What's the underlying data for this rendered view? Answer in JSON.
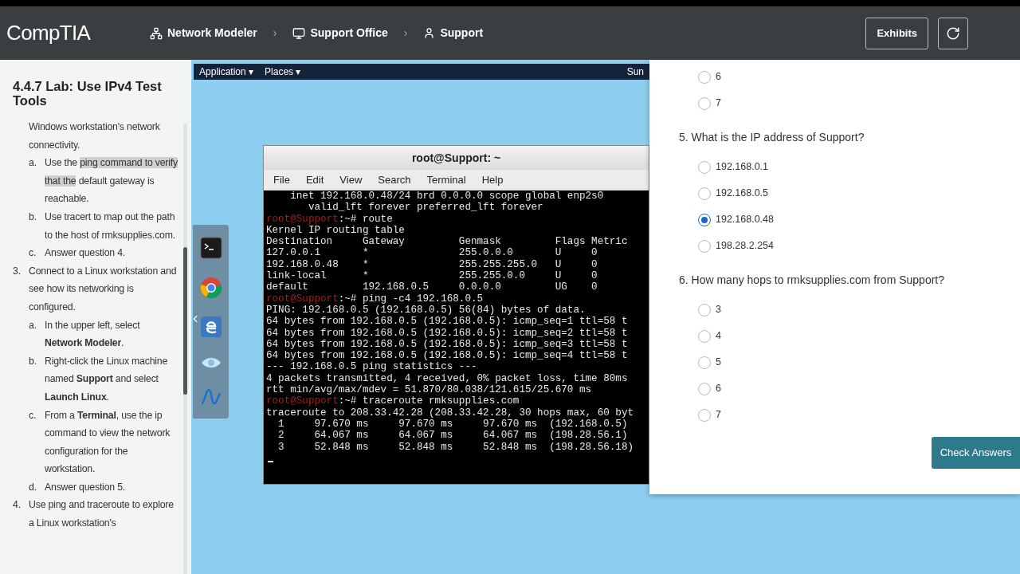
{
  "header": {
    "logo": "CompTIA",
    "breadcrumbs": [
      {
        "label": "Network Modeler"
      },
      {
        "label": "Support Office"
      },
      {
        "label": "Support"
      }
    ],
    "separator": "›",
    "exhibits": "Exhibits"
  },
  "instructions": {
    "title": "4.4.7 Lab: Use IPv4 Test Tools",
    "items": [
      {
        "segments": [
          {
            "text": "Windows workstation's network connectivity.",
            "highlighted": false
          }
        ],
        "children": [
          {
            "marker": "a.",
            "segments": [
              {
                "text": "Use the ",
                "highlighted": false
              },
              {
                "text": "ping command to verify that the",
                "highlighted": true
              },
              {
                "text": " default gateway is reachable.",
                "highlighted": false
              }
            ]
          },
          {
            "marker": "b.",
            "segments": [
              {
                "text": "Use tracert to map out the path to the host of rmksupplies.com.",
                "highlighted": false
              }
            ]
          },
          {
            "marker": "c.",
            "segments": [
              {
                "text": "Answer question 4.",
                "highlighted": false
              }
            ]
          }
        ]
      },
      {
        "marker": "3.",
        "segments": [
          {
            "text": "Connect to a Linux workstation and see how its networking is configured.",
            "highlighted": false
          }
        ],
        "children": [
          {
            "marker": "a.",
            "segments": [
              {
                "text": "In the upper left, select **Network Modeler**.",
                "highlighted": false
              }
            ]
          },
          {
            "marker": "b.",
            "segments": [
              {
                "text": "Right-click the Linux machine named **Support** and select **Launch Linux**.",
                "highlighted": false
              }
            ]
          },
          {
            "marker": "c.",
            "segments": [
              {
                "text": "From a **Terminal**, use the ip command to view the network configuration for the workstation.",
                "highlighted": false
              }
            ]
          },
          {
            "marker": "d.",
            "segments": [
              {
                "text": "Answer question 5.",
                "highlighted": false
              }
            ]
          }
        ]
      },
      {
        "marker": "4.",
        "segments": [
          {
            "text": "Use ping and traceroute to explore a Linux workstation's",
            "highlighted": false
          }
        ]
      }
    ]
  },
  "desktop": {
    "menus": [
      "Application ▾",
      "Places ▾"
    ],
    "clock": "Sun",
    "dock": [
      {
        "kind": "terminal"
      },
      {
        "kind": "browser"
      },
      {
        "kind": "edge"
      },
      {
        "kind": "eye"
      },
      {
        "kind": "wave"
      }
    ]
  },
  "terminal": {
    "title": "root@Support: ~",
    "menu": [
      "File",
      "Edit",
      "View",
      "Search",
      "Terminal",
      "Help"
    ],
    "lines": [
      {
        "text": "    inet 192.168.0.48/24 brd 0.0.0.0 scope global enp2s0"
      },
      {
        "text": "       valid_lft forever preferred_lft forever"
      },
      {
        "prompt": "root@Support",
        "text": ":~# route"
      },
      {
        "text": "Kernel IP routing table"
      },
      {
        "text": "Destination     Gateway         Genmask         Flags Metric"
      },
      {
        "text": "127.0.0.1       *               255.0.0.0       U     0"
      },
      {
        "text": "192.168.0.48    *               255.255.255.0   U     0"
      },
      {
        "text": "link-local      *               255.255.0.0     U     0"
      },
      {
        "text": "default         192.168.0.5     0.0.0.0         UG    0"
      },
      {
        "prompt": "root@Support",
        "text": ":~# ping -c4 192.168.0.5"
      },
      {
        "text": "PING: 192.168.0.5 (192.168.0.5) 56(84) bytes of data."
      },
      {
        "text": "64 bytes from 192.168.0.5 (192.168.0.5): icmp_seq=1 ttl=58 t"
      },
      {
        "text": "64 bytes from 192.168.0.5 (192.168.0.5): icmp_seq=2 ttl=58 t"
      },
      {
        "text": "64 bytes from 192.168.0.5 (192.168.0.5): icmp_seq=3 ttl=58 t"
      },
      {
        "text": "64 bytes from 192.168.0.5 (192.168.0.5): icmp_seq=4 ttl=58 t"
      },
      {
        "text": "--- 192.168.0.5 ping statistics ---"
      },
      {
        "text": "4 packets transmitted, 4 received, 0% packet loss, time 80ms"
      },
      {
        "text": "rtt min/avg/max/mdev = 51.870/80.038/121.615/25.670 ms"
      },
      {
        "prompt": "root@Support",
        "text": ":~# traceroute rmksupplies.com"
      },
      {
        "text": "traceroute to 208.33.42.28 (208.33.42.28, 30 hops max, 60 byt"
      },
      {
        "text": "  1     97.670 ms     97.670 ms     97.670 ms  (192.168.0.5)"
      },
      {
        "text": "  2     64.067 ms     64.067 ms     64.067 ms  (198.28.56.1)"
      },
      {
        "text": "  3     52.848 ms     52.848 ms     52.848 ms  (198.28.56.18)"
      }
    ]
  },
  "quiz": {
    "items": [
      {
        "kind": "option",
        "label": "6",
        "selected": false
      },
      {
        "kind": "option",
        "label": "7",
        "selected": false
      },
      {
        "kind": "question",
        "text": "5. What is the IP address of Support?"
      },
      {
        "kind": "option",
        "label": "192.168.0.1",
        "selected": false
      },
      {
        "kind": "option",
        "label": "192.168.0.5",
        "selected": false
      },
      {
        "kind": "option",
        "label": "192.168.0.48",
        "selected": true
      },
      {
        "kind": "option",
        "label": "198.28.2.254",
        "selected": false
      },
      {
        "kind": "question",
        "text": "6. How many hops to rmksupplies.com from Support?"
      },
      {
        "kind": "option",
        "label": "3",
        "selected": false
      },
      {
        "kind": "option",
        "label": "4",
        "selected": false
      },
      {
        "kind": "option",
        "label": "5",
        "selected": false
      },
      {
        "kind": "option",
        "label": "6",
        "selected": false
      },
      {
        "kind": "option",
        "label": "7",
        "selected": false
      }
    ],
    "button": "Check Answers"
  }
}
